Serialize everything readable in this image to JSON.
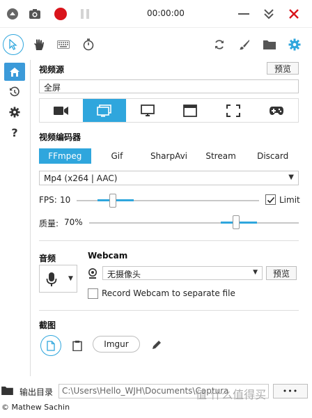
{
  "colors": {
    "accent": "#2fa6dd",
    "record": "#d9141b",
    "disabled": "#bfbfbf"
  },
  "topbar": {
    "timer": "00:00:00",
    "icons": [
      "menu-up-icon",
      "camera-icon",
      "record-icon",
      "pause-icon",
      "minimize-icon",
      "collapse-icon",
      "close-icon"
    ]
  },
  "toolbar": {
    "icons": [
      "cursor-icon",
      "hand-icon",
      "keyboard-icon",
      "timer-icon",
      "refresh-icon",
      "brush-icon",
      "folder-icon",
      "settings-icon"
    ]
  },
  "sidebar": {
    "items": [
      "home-icon",
      "history-icon",
      "settings-icon",
      "help-icon"
    ],
    "help_label": "?"
  },
  "video_source": {
    "title": "视频源",
    "preview_label": "预览",
    "value": "全屏",
    "tabs": [
      "camera-icon",
      "screen-icon",
      "monitor-icon",
      "window-icon",
      "region-icon",
      "gamepad-icon"
    ],
    "active_tab": 1
  },
  "encoder": {
    "title": "视频编码器",
    "tabs": [
      "FFmpeg",
      "Gif",
      "SharpAvi",
      "Stream",
      "Discard"
    ],
    "active_tab": 0,
    "format": "Mp4 (x264 | AAC)",
    "fps_label": "FPS:",
    "fps_value": "10",
    "limit_label": "Limit",
    "limit_checked": true,
    "quality_label": "质量:",
    "quality_value": "70%",
    "fps_slider_fraction": 0.2,
    "quality_slider_fraction": 0.7
  },
  "audio": {
    "title": "音频"
  },
  "webcam": {
    "title": "Webcam",
    "value": "无摄像头",
    "preview_label": "预览",
    "separate_label": "Record Webcam to separate file"
  },
  "screenshot": {
    "title": "截图",
    "imgur_label": "Imgur"
  },
  "output": {
    "label": "输出目录",
    "path": "C:\\Users\\Hello_WJH\\Documents\\Captura",
    "more_label": "•••"
  },
  "status": {
    "copyright": "© Mathew Sachin"
  },
  "watermark": "值 什么值得买"
}
